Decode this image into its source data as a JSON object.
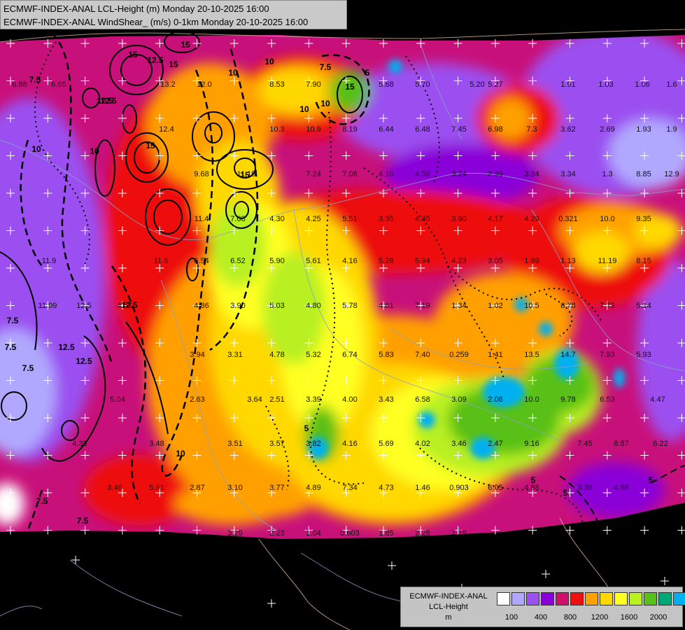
{
  "header": {
    "line1": "ECMWF-INDEX-ANAL LCL-Height (m) Monday 20-10-2025 16:00",
    "line2": "ECMWF-INDEX-ANAL WindShear_ (m/s) 0-1km Monday 20-10-2025 16:00"
  },
  "legend": {
    "title1": "ECMWF-INDEX-ANAL",
    "title2": "LCL-Height",
    "unit": "m",
    "colors": [
      "#ffffff",
      "#b0a8ff",
      "#9b50f0",
      "#8a00d8",
      "#d0106a",
      "#ee1010",
      "#ffa000",
      "#ffd800",
      "#ffff20",
      "#b8f020",
      "#58c018",
      "#00a878",
      "#00b0f0"
    ],
    "ticks": [
      "100",
      "400",
      "800",
      "1200",
      "1600",
      "2000"
    ]
  },
  "values": [
    "6.88",
    "6.65",
    "13.2",
    "12.0",
    "8.53",
    "7.90",
    "5.68",
    "5.70",
    "5.20",
    "5.27",
    "1.91",
    "1.03",
    "1.06",
    "1.6",
    "12.4",
    "10.3",
    "10.9",
    "8.19",
    "6.44",
    "6.48",
    "7.45",
    "6.98",
    "7.3",
    "3.62",
    "2.69",
    "1.93",
    "1.9",
    "9.68",
    "11.15",
    "7.24",
    "7.08",
    "4.10",
    "4.56",
    "3.24",
    "2.99",
    "3.34",
    "3.34",
    "1.3",
    "8.85",
    "12.9",
    "11.4",
    "7.08",
    "4.30",
    "4.25",
    "5.51",
    "3.35",
    "4.45",
    "3.90",
    "4.17",
    "4.29",
    "0.321",
    "10.0",
    "9.35",
    "11.9",
    "11.6",
    "6.54",
    "6.52",
    "5.90",
    "5.61",
    "4.16",
    "5.28",
    "5.94",
    "4.23",
    "3.05",
    "1.99",
    "1.13",
    "11.19",
    "8.15",
    "11.99",
    "12.5",
    "4.57",
    "4.86",
    "3.90",
    "5.03",
    "4.80",
    "5.78",
    "4.61",
    "7.19",
    "1.34",
    "1.02",
    "10.5",
    "8.78",
    "7.73",
    "5.14",
    "3.94",
    "3.31",
    "4.78",
    "5.32",
    "6.74",
    "5.83",
    "7.40",
    "0.259",
    "1.41",
    "13.5",
    "14.7",
    "7.93",
    "5.93",
    "5.04",
    "2.63",
    "3.64",
    "2.51",
    "3.39",
    "4.00",
    "3.43",
    "6.58",
    "3.09",
    "2.06",
    "10.0",
    "9.78",
    "6.53",
    "4.47",
    "4.38",
    "3.48",
    "3.51",
    "3.57",
    "3.82",
    "4.16",
    "5.69",
    "4.02",
    "3.46",
    "2.47",
    "9.16",
    "7.45",
    "8.87",
    "6.22",
    "3.46",
    "5.61",
    "2.87",
    "3.10",
    "3.77",
    "4.89",
    "7.34",
    "4.73",
    "1.46",
    "0.903",
    "6.05",
    "4.88",
    "3.38",
    "4.88",
    "3.29",
    "2.23",
    "1.04",
    "0.603",
    "1.85",
    "2.28",
    "7.79"
  ],
  "contour_labels": [
    "15",
    "12.5",
    "15",
    "15",
    "10",
    "7.5",
    "15",
    "10",
    "10",
    "12.5",
    "15",
    "12.5",
    "7.5",
    "12.5",
    "10",
    "7.5",
    "5",
    "7.5",
    "10",
    "12.5",
    "5",
    "5",
    "7.5",
    "7.5",
    "5",
    "12.5",
    "10",
    "10",
    "7.5",
    "5",
    "15"
  ]
}
